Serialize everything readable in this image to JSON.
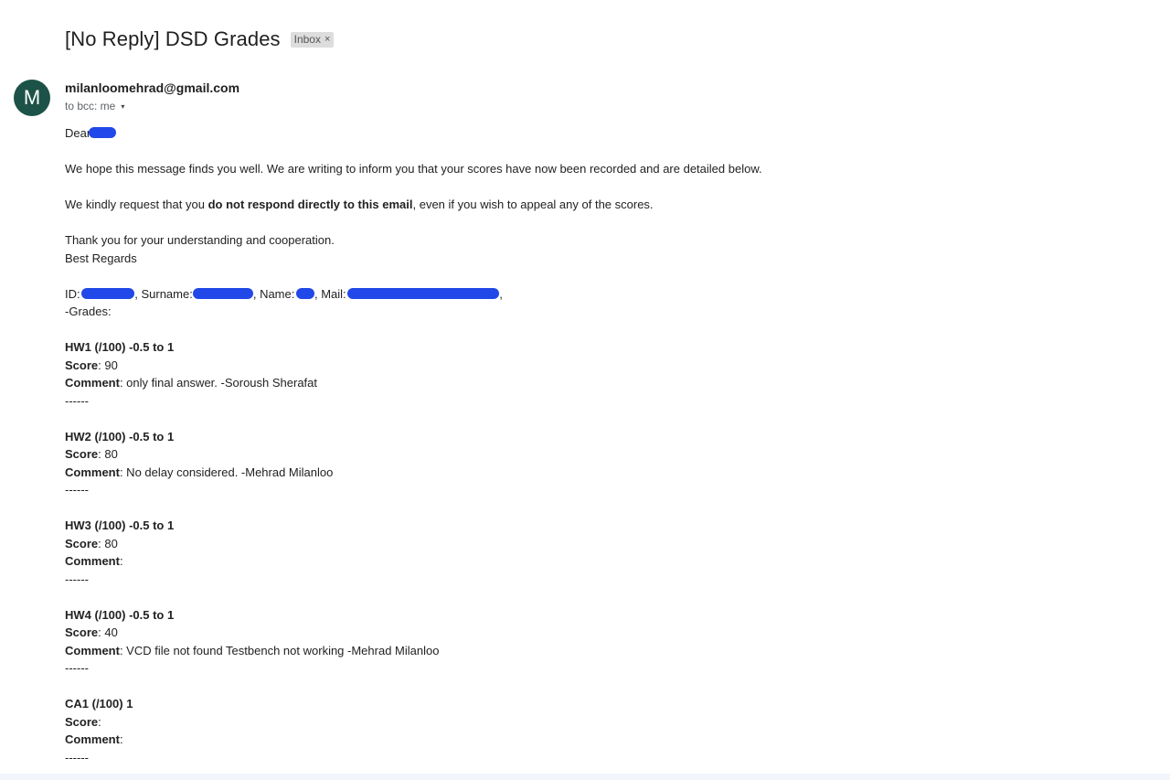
{
  "email": {
    "subject": "[No Reply] DSD Grades",
    "label": "Inbox",
    "label_remove": "×",
    "avatar_letter": "M",
    "sender": "milanloomehrad@gmail.com",
    "recipients": "to bcc: me",
    "caret": "▾"
  },
  "message": {
    "greeting": "Dear",
    "intro": "We hope this message finds you well. We are writing to inform you that your scores have now been recorded and are detailed below.",
    "request_prefix": "We kindly request that you ",
    "request_bold": "do not respond directly to this email",
    "request_suffix": ", even if you wish to appeal any of the scores.",
    "thanks": "Thank you for your understanding and cooperation.",
    "regards": "Best Regards",
    "id_label": "ID:",
    "surname_label": ", Surname:",
    "name_label": ", Name:",
    "mail_label": ", Mail:",
    "trailing_comma": ",",
    "grades_header": "-Grades:"
  },
  "grades": [
    {
      "title": "HW1 (/100) -0.5 to 1",
      "score_label": "Score",
      "score": ": 90",
      "comment_label": "Comment",
      "comment": ": only final answer. -Soroush Sherafat",
      "separator": "------"
    },
    {
      "title": "HW2 (/100) -0.5 to 1",
      "score_label": "Score",
      "score": ": 80",
      "comment_label": "Comment",
      "comment": ": No delay considered. -Mehrad Milanloo",
      "separator": "------"
    },
    {
      "title": "HW3 (/100) -0.5 to 1",
      "score_label": "Score",
      "score": ": 80",
      "comment_label": "Comment",
      "comment": ":",
      "separator": "------"
    },
    {
      "title": "HW4 (/100) -0.5 to 1",
      "score_label": "Score",
      "score": ": 40",
      "comment_label": "Comment",
      "comment": ": VCD file not found Testbench not working -Mehrad Milanloo",
      "separator": "------"
    },
    {
      "title": "CA1 (/100) 1",
      "score_label": "Score",
      "score": ":",
      "comment_label": "Comment",
      "comment": ":",
      "separator": "------"
    }
  ],
  "colors": {
    "avatar_bg": "#1c5247",
    "redaction": "#2148e8",
    "label_chip": "#dddddd"
  }
}
